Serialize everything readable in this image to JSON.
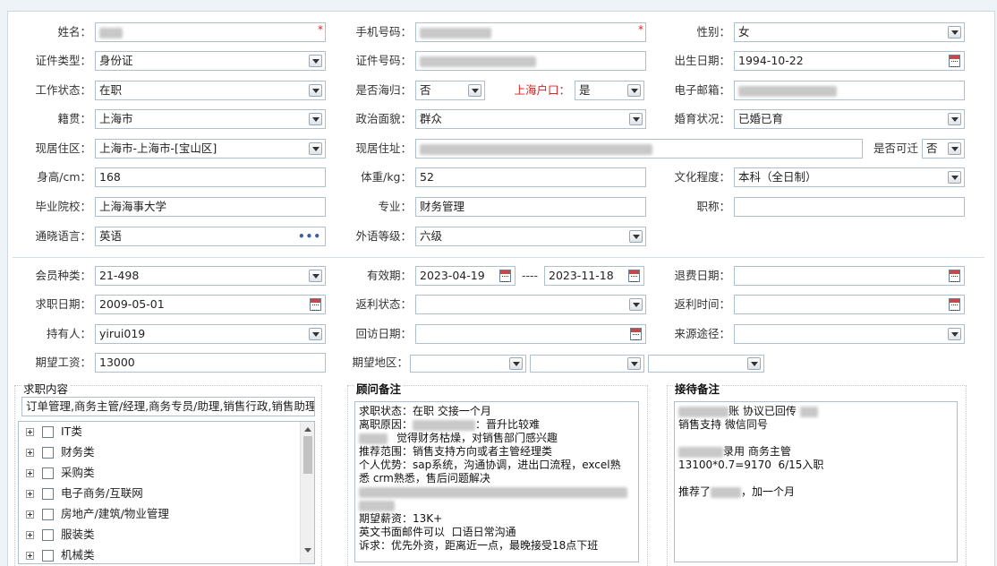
{
  "basic": {
    "name_label": "姓名：",
    "mobile_label": "手机号码：",
    "gender_label": "性别：",
    "gender_value": "女",
    "id_type_label": "证件类型：",
    "id_type_value": "身份证",
    "id_number_label": "证件号码：",
    "birth_label": "出生日期：",
    "birth_value": "1994-10-22",
    "work_status_label": "工作状态：",
    "work_status_value": "在职",
    "returnee_label": "是否海归：",
    "returnee_value": "否",
    "shanghai_hukou_label": "上海户口：",
    "shanghai_hukou_value": "是",
    "email_label": "电子邮箱：",
    "native_label": "籍贯：",
    "native_value": "上海市",
    "political_label": "政治面貌：",
    "political_value": "群众",
    "marital_label": "婚育状况：",
    "marital_value": "已婚已育",
    "residence_area_label": "现居住区：",
    "residence_area_value": "上海市-上海市-[宝山区]",
    "residence_addr_label": "现居住址：",
    "relocate_label": "是否可迁",
    "relocate_value": "否",
    "height_label": "身高/cm：",
    "height_value": "168",
    "weight_label": "体重/kg：",
    "weight_value": "52",
    "education_label": "文化程度：",
    "education_value": "本科（全日制）",
    "school_label": "毕业院校：",
    "school_value": "上海海事大学",
    "major_label": "专业：",
    "major_value": "财务管理",
    "title_label": "职称：",
    "language_label": "通晓语言：",
    "language_value": "英语",
    "language_level_label": "外语等级：",
    "language_level_value": "六级",
    "required_mark": "*"
  },
  "membership": {
    "member_type_label": "会员种类：",
    "member_type_value": "21-498",
    "valid_label": "有效期：",
    "valid_from": "2023-04-19",
    "valid_sep": "----",
    "valid_to": "2023-11-18",
    "refund_date_label": "退费日期：",
    "job_date_label": "求职日期：",
    "job_date_value": "2009-05-01",
    "rebate_status_label": "返利状态：",
    "rebate_time_label": "返利时间：",
    "holder_label": "持有人：",
    "holder_value": "yirui019",
    "visit_date_label": "回访日期：",
    "source_label": "来源途径：",
    "salary_label": "期望工资：",
    "salary_value": "13000",
    "region_label": "期望地区："
  },
  "job_content": {
    "title": "求职内容",
    "summary": "订单管理,商务主管/经理,商务专员/助理,销售行政,销售助理",
    "tree_items": [
      "IT类",
      "财务类",
      "采购类",
      "电子商务/互联网",
      "房地产/建筑/物业管理",
      "服装类",
      "机械类"
    ]
  },
  "advisor_notes": {
    "title": "顾问备注",
    "line1": "求职状态：在职 交接一个月",
    "line2_prefix": "离职原因：",
    "line2_suffix": "：晋升比较难",
    "line3_suffix": "觉得财务枯燥，对销售部门感兴趣",
    "line4": "推荐范围：销售支持方向或者主管经理类",
    "line5": "个人优势：sap系统，沟通协调，进出口流程，excel熟",
    "line6": "悉 crm熟悉，售后问题解决",
    "line8": "期望薪资：13K+",
    "line9": "英文书面邮件可以  口语日常沟通",
    "line10": "诉求：优先外资，距离近一点，最晚接受18点下班"
  },
  "reception_notes": {
    "title": "接待备注",
    "line1_a": "账 协议已回传",
    "line2": "销售支持 微信同号",
    "line4_suffix": "录用 商务主管",
    "line5": "13100*0.7=9170  6/15入职",
    "line7_prefix": "推荐了",
    "line7_suffix": "，加一个月"
  },
  "icons": {
    "dropdown": "chevron-down-icon",
    "calendar": "calendar-icon",
    "more": "ellipsis-icon",
    "expand": "plus-box-icon"
  },
  "colors": {
    "required": "#e02020",
    "border": "#aebfd0"
  }
}
